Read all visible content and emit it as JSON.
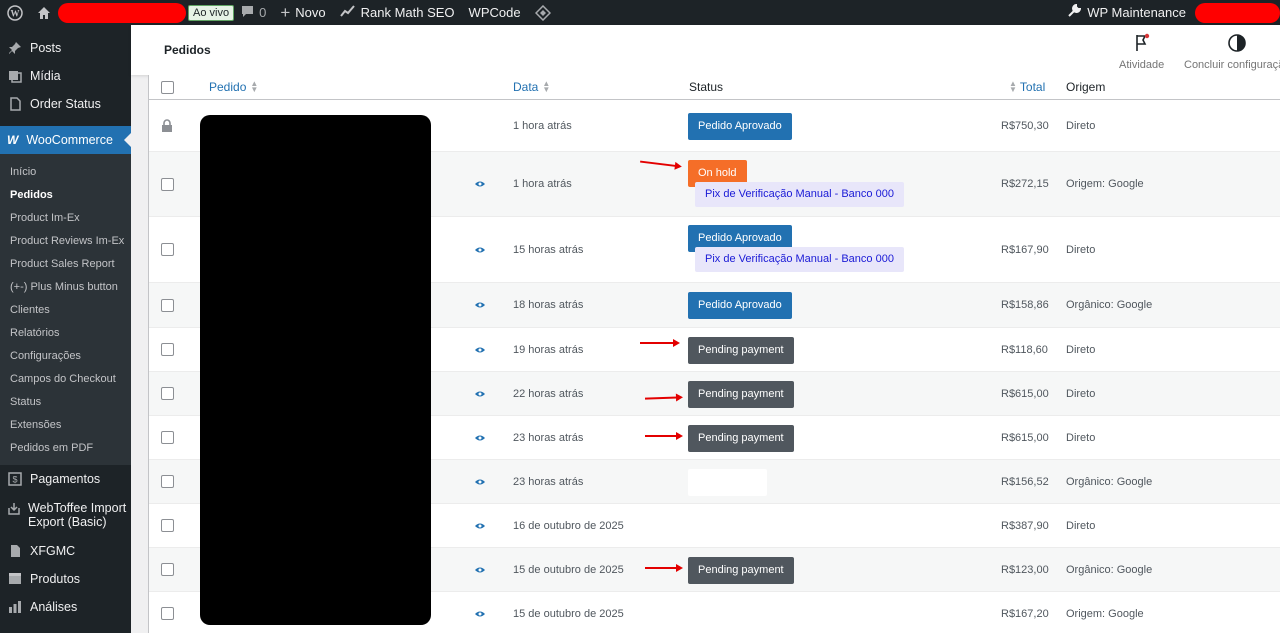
{
  "adminbar": {
    "live_badge": "Ao vivo",
    "comments_count": "0",
    "new_label": "Novo",
    "rankmath_label": "Rank Math SEO",
    "wpcode_label": "WPCode",
    "maintenance_label": "WP Maintenance"
  },
  "sidebar": {
    "top_items": [
      {
        "label": "Posts",
        "icon": "pin-icon"
      },
      {
        "label": "Mídia",
        "icon": "media-icon"
      },
      {
        "label": "Order Status",
        "icon": "document-icon"
      }
    ],
    "woocommerce": "WooCommerce",
    "submenu": [
      "Início",
      "Pedidos",
      "Product Im-Ex",
      "Product Reviews Im-Ex",
      "Product Sales Report",
      "(+-) Plus Minus button",
      "Clientes",
      "Relatórios",
      "Configurações",
      "Campos do Checkout",
      "Status",
      "Extensões",
      "Pedidos em PDF"
    ],
    "bottom_items": [
      {
        "label": "Pagamentos",
        "icon": "dollar-icon"
      },
      {
        "label": "WebToffee Import Export (Basic)",
        "icon": "import-icon"
      },
      {
        "label": "XFGMC",
        "icon": "file-icon"
      },
      {
        "label": "Produtos",
        "icon": "box-icon"
      },
      {
        "label": "Análises",
        "icon": "bar-chart-icon"
      }
    ]
  },
  "header": {
    "title": "Pedidos",
    "activity": "Atividade",
    "finish_setup": "Concluir configuração"
  },
  "table": {
    "columns": {
      "order": "Pedido",
      "date": "Data",
      "status": "Status",
      "total": "Total",
      "origin": "Origem"
    },
    "rows": [
      {
        "date": "1 hora atrás",
        "status": "Pedido Aprovado",
        "status_type": "blue",
        "pix": "",
        "total": "R$750,30",
        "origin": "Direto"
      },
      {
        "date": "1 hora atrás",
        "status": "On hold",
        "status_type": "orange",
        "pix": "Pix de Verificação Manual - Banco 000",
        "total": "R$272,15",
        "origin": "Origem: Google"
      },
      {
        "date": "15 horas atrás",
        "status": "Pedido Aprovado",
        "status_type": "blue",
        "pix": "Pix de Verificação Manual - Banco 000",
        "total": "R$167,90",
        "origin": "Direto"
      },
      {
        "date": "18 horas atrás",
        "status": "Pedido Aprovado",
        "status_type": "blue",
        "pix": "",
        "total": "R$158,86",
        "origin": "Orgânico: Google"
      },
      {
        "date": "19 horas atrás",
        "status": "Pending payment",
        "status_type": "gray",
        "pix": "",
        "total": "R$118,60",
        "origin": "Direto"
      },
      {
        "date": "22 horas atrás",
        "status": "Pending payment",
        "status_type": "gray",
        "pix": "",
        "total": "R$615,00",
        "origin": "Direto"
      },
      {
        "date": "23 horas atrás",
        "status": "Pending payment",
        "status_type": "gray",
        "pix": "",
        "total": "R$615,00",
        "origin": "Direto"
      },
      {
        "date": "23 horas atrás",
        "status": "",
        "status_type": "blank",
        "pix": "",
        "total": "R$156,52",
        "origin": "Orgânico: Google"
      },
      {
        "date": "16 de outubro de 2025",
        "status": "",
        "status_type": "blank",
        "pix": "",
        "total": "R$387,90",
        "origin": "Direto"
      },
      {
        "date": "15 de outubro de 2025",
        "status": "Pending payment",
        "status_type": "gray",
        "pix": "",
        "total": "R$123,00",
        "origin": "Orgânico: Google"
      },
      {
        "date": "15 de outubro de 2025",
        "status": "",
        "status_type": "blank",
        "pix": "",
        "total": "R$167,20",
        "origin": "Origem: Google"
      }
    ]
  }
}
